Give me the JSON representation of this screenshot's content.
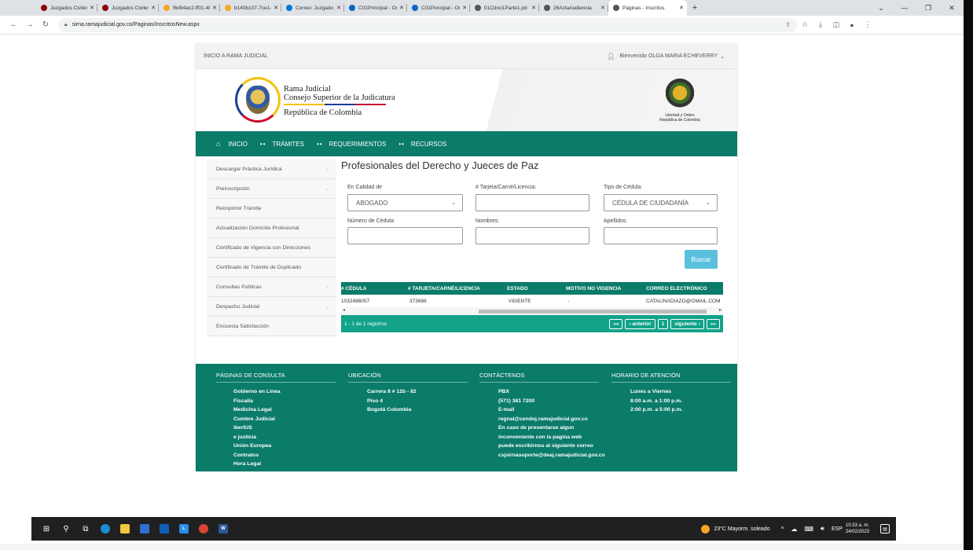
{
  "browser": {
    "tabs": [
      {
        "label": "Juzgados Civiles d",
        "color": "#8b0000",
        "active": false
      },
      {
        "label": "Juzgados Civiles d",
        "color": "#8b0000",
        "active": false
      },
      {
        "label": "f6d94ac2-ff01-4bc",
        "color": "#f5a623",
        "active": false
      },
      {
        "label": "b140b107-7ce1-4",
        "color": "#f5a623",
        "active": false
      },
      {
        "label": "Correo: Juzgado 0",
        "color": "#0078d4",
        "active": false
      },
      {
        "label": "C01Principal - One",
        "color": "#0a64c8",
        "active": false
      },
      {
        "label": "C01Principal - One",
        "color": "#0a64c8",
        "active": false
      },
      {
        "label": "01Cdno1Parte1.pd",
        "color": "#555555",
        "active": false
      },
      {
        "label": "26ActaAudiencia",
        "color": "#555555",
        "active": false
      },
      {
        "label": "Páginas - Inscritos",
        "color": "#555555",
        "active": true
      }
    ],
    "url": "sirna.ramajudicial.gov.co/Paginas/InscritosNew.aspx"
  },
  "site": {
    "top_link": "INICIO A RAMA JUDICIAL",
    "welcome": "Bienvenido OLGA MARIA ECHEVERRY",
    "brand_line1": "Rama Judicial",
    "brand_line2": "Consejo Superior de la Judicatura",
    "brand_line3": "República de Colombia",
    "motto_line1": "Libertad y Orden",
    "motto_line2": "República de Colombia",
    "nav": [
      "INICIO",
      "TRÁMITES",
      "REQUERIMIENTOS",
      "RECURSOS"
    ]
  },
  "sidebar": {
    "items": [
      {
        "label": "Descargar Práctica Jurídica",
        "has_chevron": true
      },
      {
        "label": "Preinscripción",
        "has_chevron": true
      },
      {
        "label": "Reimprimir Trámite",
        "has_chevron": false
      },
      {
        "label": "Actualización Domicilio Profesional",
        "has_chevron": false
      },
      {
        "label": "Certificado de Vigencia con Direcciones",
        "has_chevron": false
      },
      {
        "label": "Certificado de Trámite de Duplicado",
        "has_chevron": false
      },
      {
        "label": "Consultas Publicas",
        "has_chevron": true
      },
      {
        "label": "Despacho Judicial",
        "has_chevron": true
      },
      {
        "label": "Encuesta Satisfacción",
        "has_chevron": false
      }
    ]
  },
  "form": {
    "title": "Profesionales del Derecho y Jueces de Paz",
    "calidad_label": "En Calidad de",
    "calidad_value": "ABOGADO",
    "tarjeta_label": "# Tarjeta/Carné/Licencia:",
    "tarjeta_value": "",
    "tipo_label": "Tipo de Cédula:",
    "tipo_value": "CÉDULA DE CIUDADANÍA",
    "cedula_label": "Número de Cédula:",
    "cedula_value": "",
    "nombres_label": "Nombres:",
    "nombres_value": "",
    "apellidos_label": "Apellidos:",
    "apellidos_value": "",
    "buscar_label": "Buscar"
  },
  "results": {
    "headers": [
      "# CÉDULA",
      "# TARJETA/CARNÉ/LICENCIA",
      "ESTADO",
      "MOTIVO NO VIGENCIA",
      "CORREO ELECTRÓNICO"
    ],
    "rows": [
      [
        "1032486057",
        "373686",
        "VIGENTE",
        "-",
        "CATALINADIAZO@GMAIL.COM"
      ]
    ],
    "summary": "1 - 1 de 1 registros",
    "pager": {
      "first": "««",
      "prev": "‹ anterior",
      "page": "1",
      "next": "siguiente ›",
      "last": "»»"
    }
  },
  "footer": {
    "columns": [
      {
        "heading": "PÁGINAS DE CONSULTA",
        "lines": [
          "Gobierno en Línea",
          "Fiscalía",
          "Medicina Legal",
          "Cumbre Judicial",
          "iberIUS",
          "e justicia",
          "Unión Europea",
          "Contratos",
          "Hora Legal"
        ]
      },
      {
        "heading": "UBICACIÓN",
        "lines": [
          "Carrera 8 # 12b - 82",
          "Piso 4",
          "Bogotá Colombia"
        ]
      },
      {
        "heading": "CONTÁCTENOS",
        "lines": [
          "PBX",
          "(571) 381 7200",
          "E-mail",
          "regnal@cendoj.ramajudicial.gov.co",
          "En caso de presentarse algun",
          "inconveniente con la pagina web",
          "puede escribirnos al siguiente correo",
          "csjsirnasoporte@deaj.ramajudicial.gov.co"
        ]
      },
      {
        "heading": "HORARIO DE ATENCIÓN",
        "lines": [
          "Lunes a Viernes",
          "8:00 a.m. a 1:00 p.m.",
          "2:00 p.m. a 5:00 p.m."
        ]
      }
    ]
  },
  "taskbar": {
    "weather": "23°C  Mayorm. soleado",
    "lang": "ESP",
    "time": "10:33 a. m.",
    "date": "24/02/2023"
  },
  "colors": {
    "brand_green": "#0b7b6a",
    "pager_green": "#12a38a",
    "button_blue": "#5bc0de"
  }
}
